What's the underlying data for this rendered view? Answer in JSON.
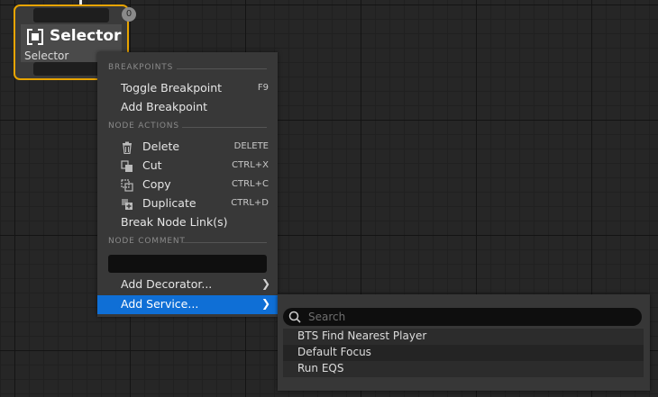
{
  "node": {
    "title": "Selector",
    "subtitle": "Selector",
    "badge": "0",
    "icon": "selector-icon",
    "accent": "#e8a400"
  },
  "menu": {
    "sections": {
      "breakpoints": "BREAKPOINTS",
      "node_actions": "NODE ACTIONS",
      "node_comment": "NODE COMMENT"
    },
    "toggle_breakpoint": {
      "label": "Toggle Breakpoint",
      "shortcut": "F9"
    },
    "add_breakpoint": {
      "label": "Add Breakpoint"
    },
    "delete": {
      "label": "Delete",
      "shortcut": "DELETE",
      "icon": "trash-icon"
    },
    "cut": {
      "label": "Cut",
      "shortcut": "CTRL+X",
      "icon": "cut-icon"
    },
    "copy": {
      "label": "Copy",
      "shortcut": "CTRL+C",
      "icon": "copy-icon"
    },
    "duplicate": {
      "label": "Duplicate",
      "shortcut": "CTRL+D",
      "icon": "duplicate-icon"
    },
    "break_links": {
      "label": "Break Node Link(s)"
    },
    "comment_value": "",
    "add_decorator": {
      "label": "Add Decorator..."
    },
    "add_service": {
      "label": "Add Service..."
    },
    "highlight": "#0f6fd6"
  },
  "submenu": {
    "search_placeholder": "Search",
    "items": [
      "BTS Find Nearest Player",
      "Default Focus",
      "Run EQS"
    ]
  }
}
